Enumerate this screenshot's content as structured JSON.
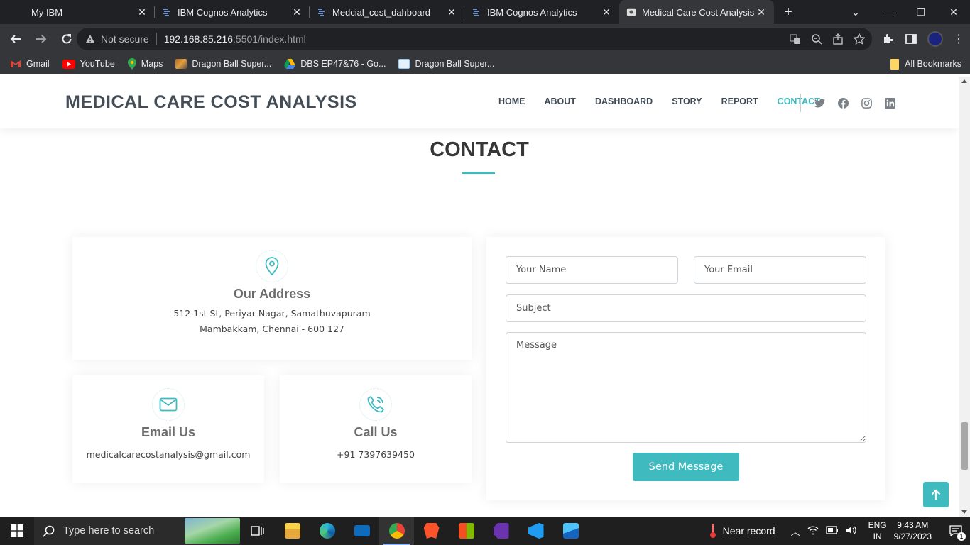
{
  "browser": {
    "tabs": [
      {
        "title": "My IBM",
        "active": false
      },
      {
        "title": "IBM Cognos Analytics",
        "active": false
      },
      {
        "title": "Medcial_cost_dahboard",
        "active": false
      },
      {
        "title": "IBM Cognos Analytics",
        "active": false
      },
      {
        "title": "Medical Care Cost Analysis",
        "active": true
      }
    ],
    "new_tab": "+",
    "security_label": "Not secure",
    "url_host": "192.168.85.216",
    "url_path": ":5501/index.html",
    "bookmarks": [
      {
        "label": "Gmail",
        "icon": "gmail-icon"
      },
      {
        "label": "YouTube",
        "icon": "youtube-icon"
      },
      {
        "label": "Maps",
        "icon": "maps-icon"
      },
      {
        "label": "Dragon Ball Super...",
        "icon": "image-icon"
      },
      {
        "label": "DBS EP47&76 - Go...",
        "icon": "drive-icon"
      },
      {
        "label": "Dragon Ball Super...",
        "icon": "site-icon"
      }
    ],
    "all_bookmarks": "All Bookmarks"
  },
  "site": {
    "logo": "MEDICAL CARE COST ANALYSIS",
    "nav": [
      {
        "label": "HOME",
        "active": false
      },
      {
        "label": "ABOUT",
        "active": false
      },
      {
        "label": "DASHBOARD",
        "active": false
      },
      {
        "label": "STORY",
        "active": false
      },
      {
        "label": "REPORT",
        "active": false
      },
      {
        "label": "CONTACT",
        "active": true
      }
    ],
    "socials": [
      "twitter-icon",
      "facebook-icon",
      "instagram-icon",
      "linkedin-icon"
    ],
    "accent_color": "#3fbbc0"
  },
  "contact": {
    "title": "CONTACT",
    "address": {
      "heading": "Our Address",
      "line1": "512 1st St, Periyar Nagar, Samathuvapuram",
      "line2": "Mambakkam, Chennai - 600 127"
    },
    "email": {
      "heading": "Email Us",
      "value": "medicalcarecostanalysis@gmail.com"
    },
    "phone": {
      "heading": "Call Us",
      "value": "+91 7397639450"
    },
    "form": {
      "name_placeholder": "Your Name",
      "email_placeholder": "Your Email",
      "subject_placeholder": "Subject",
      "message_placeholder": "Message",
      "submit_label": "Send Message"
    }
  },
  "taskbar": {
    "search_placeholder": "Type here to search",
    "weather": "Near record",
    "lang_top": "ENG",
    "lang_bottom": "IN",
    "time": "9:43 AM",
    "date": "9/27/2023",
    "notification_count": "1"
  }
}
